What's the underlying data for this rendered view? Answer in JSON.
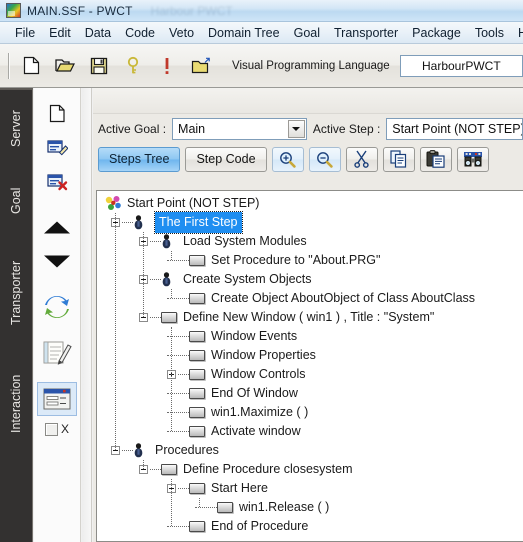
{
  "window": {
    "title": "MAIN.SSF  - PWCT",
    "title_ghost": "Harbour  PWCT",
    "app_icon": "pwct-logo-icon"
  },
  "menubar": {
    "items": [
      {
        "label": "File"
      },
      {
        "label": "Edit"
      },
      {
        "label": "Data"
      },
      {
        "label": "Code"
      },
      {
        "label": "Veto"
      },
      {
        "label": "Domain Tree"
      },
      {
        "label": "Goal"
      },
      {
        "label": "Transporter"
      },
      {
        "label": "Package"
      },
      {
        "label": "Tools"
      },
      {
        "label": "Help"
      }
    ]
  },
  "toolbar": {
    "buttons": [
      {
        "icon": "new-file-icon",
        "name": "new-file-button"
      },
      {
        "icon": "open-folder-icon",
        "name": "open-file-button"
      },
      {
        "icon": "save-disk-icon",
        "name": "save-button"
      },
      {
        "icon": "help-key-icon",
        "name": "help-button"
      },
      {
        "icon": "exclamation-icon",
        "name": "run-button"
      },
      {
        "icon": "folder-export-icon",
        "name": "export-button"
      }
    ],
    "language_label": "Visual Programming Language",
    "language_value": "HarbourPWCT"
  },
  "vertical_tabs": {
    "items": [
      {
        "label": "Server"
      },
      {
        "label": "Goal"
      },
      {
        "label": "Transporter"
      },
      {
        "label": "Interaction"
      }
    ]
  },
  "rail": {
    "items": [
      {
        "icon": "new-page-icon",
        "name": "rail-new-step"
      },
      {
        "icon": "edit-step-icon",
        "name": "rail-edit-step"
      },
      {
        "icon": "delete-step-icon",
        "name": "rail-delete-step"
      },
      {
        "icon": "arrow-up-icon",
        "name": "rail-move-up"
      },
      {
        "icon": "arrow-down-icon",
        "name": "rail-move-down"
      },
      {
        "icon": "refresh-arrows-icon",
        "name": "rail-refresh"
      },
      {
        "icon": "notebook-pencil-icon",
        "name": "rail-notes"
      },
      {
        "icon": "form-window-icon",
        "name": "rail-form"
      }
    ],
    "checkbox_label": "X"
  },
  "goal_bar": {
    "active_goal_label": "Active Goal :",
    "active_goal_value": "Main",
    "active_step_label": "Active Step :",
    "active_step_value": "Start Point (NOT STEP)"
  },
  "tabstrip": {
    "tabs": [
      {
        "label": "Steps Tree",
        "active": true
      },
      {
        "label": "Step Code",
        "active": false
      }
    ],
    "icon_buttons": [
      {
        "icon": "zoom-in-icon",
        "name": "zoom-in-button"
      },
      {
        "icon": "zoom-out-icon",
        "name": "zoom-out-button"
      },
      {
        "icon": "scissors-cut-icon",
        "name": "cut-button"
      },
      {
        "icon": "copy-icon",
        "name": "copy-button"
      },
      {
        "icon": "paste-clipboard-icon",
        "name": "paste-button"
      },
      {
        "icon": "binoculars-search-icon",
        "name": "find-button"
      }
    ]
  },
  "tree": {
    "nodes": [
      {
        "label": "Start Point (NOT STEP)",
        "depth": 0,
        "icon": "root-flower-icon",
        "toggle": "none",
        "selected": false
      },
      {
        "label": "The First Step",
        "depth": 1,
        "icon": "step-person-icon",
        "toggle": "minus",
        "selected": true
      },
      {
        "label": "Load System Modules",
        "depth": 2,
        "icon": "step-person-icon",
        "toggle": "minus",
        "selected": false
      },
      {
        "label": "Set Procedure to \"About.PRG\"",
        "depth": 3,
        "icon": "step-box-icon",
        "toggle": "none",
        "selected": false
      },
      {
        "label": "Create System Objects",
        "depth": 2,
        "icon": "step-person-icon",
        "toggle": "minus",
        "selected": false
      },
      {
        "label": "Create Object AboutObject of Class AboutClass",
        "depth": 3,
        "icon": "step-box-icon",
        "toggle": "none",
        "selected": false
      },
      {
        "label": "Define New Window  ( win1 ) , Title : \"System\"",
        "depth": 2,
        "icon": "step-box-icon",
        "toggle": "minus",
        "selected": false
      },
      {
        "label": "Window Events",
        "depth": 3,
        "icon": "step-box-icon",
        "toggle": "none",
        "selected": false
      },
      {
        "label": "Window Properties",
        "depth": 3,
        "icon": "step-box-icon",
        "toggle": "none",
        "selected": false
      },
      {
        "label": "Window Controls",
        "depth": 3,
        "icon": "step-box-icon",
        "toggle": "plus",
        "selected": false
      },
      {
        "label": "End Of Window",
        "depth": 3,
        "icon": "step-box-icon",
        "toggle": "none",
        "selected": false
      },
      {
        "label": "win1.Maximize ( )",
        "depth": 3,
        "icon": "step-box-icon",
        "toggle": "none",
        "selected": false
      },
      {
        "label": "Activate window",
        "depth": 3,
        "icon": "step-box-icon",
        "toggle": "none",
        "selected": false
      },
      {
        "label": "Procedures",
        "depth": 1,
        "icon": "step-person-icon",
        "toggle": "minus",
        "selected": false
      },
      {
        "label": "Define Procedure closesystem",
        "depth": 2,
        "icon": "step-box-icon",
        "toggle": "minus",
        "selected": false
      },
      {
        "label": "Start Here",
        "depth": 3,
        "icon": "step-box-icon",
        "toggle": "minus",
        "selected": false
      },
      {
        "label": "win1.Release ( )",
        "depth": 4,
        "icon": "step-box-icon",
        "toggle": "none",
        "selected": false
      },
      {
        "label": "End of Procedure",
        "depth": 3,
        "icon": "step-box-icon",
        "toggle": "none",
        "selected": false
      }
    ]
  },
  "colors": {
    "selection_blue": "#1f8ef1",
    "active_tab_blue": "#8ec7f2",
    "sidebar_dark": "#333130",
    "toolbar_gray": "#eceae5"
  }
}
